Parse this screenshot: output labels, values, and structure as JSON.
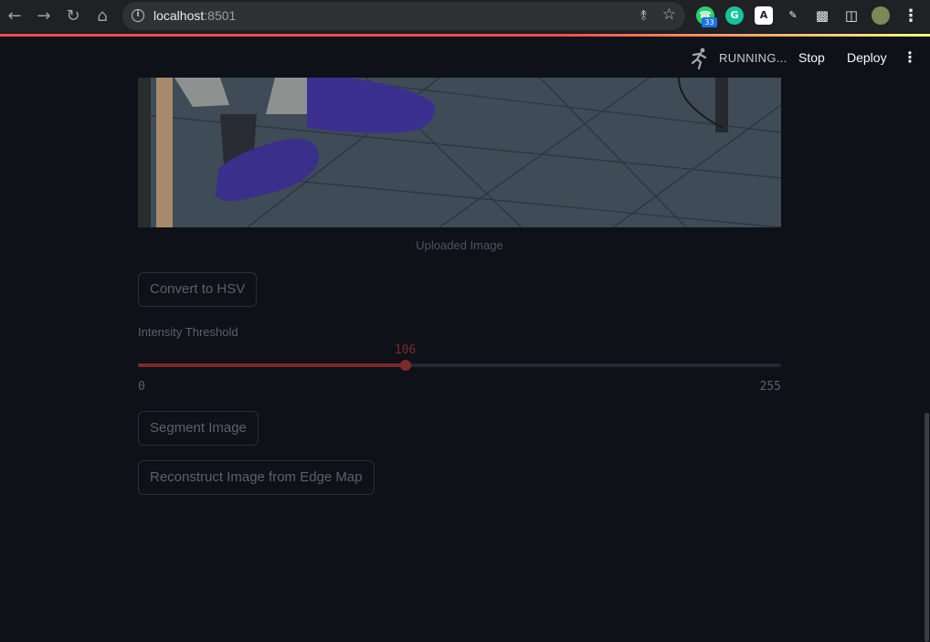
{
  "browser": {
    "url_host": "localhost",
    "url_port": ":8501",
    "notification_badge": "33"
  },
  "header": {
    "status": "RUNNING...",
    "stop_label": "Stop",
    "deploy_label": "Deploy"
  },
  "image": {
    "caption": "Uploaded Image"
  },
  "buttons": {
    "convert_hsv": "Convert to HSV",
    "segment": "Segment Image",
    "reconstruct": "Reconstruct Image from Edge Map"
  },
  "slider": {
    "label": "Intensity Threshold",
    "value": 106,
    "value_text": "106",
    "min": 0,
    "max": 255,
    "min_text": "0",
    "max_text": "255"
  },
  "colors": {
    "background": "#0e1117",
    "accent": "#7d2a2c",
    "muted_text": "#5c6069"
  }
}
